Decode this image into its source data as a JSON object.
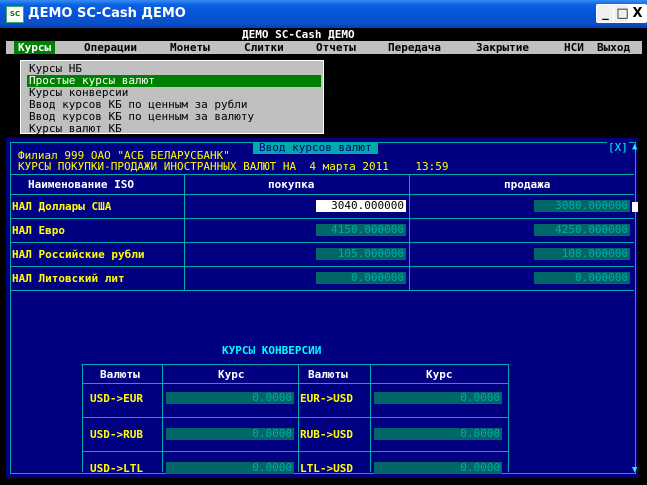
{
  "window": {
    "title": "ДЕМО SC-Cash ДЕМО",
    "icon_text": "SC",
    "min_glyph": "_",
    "max_glyph": "□",
    "close_glyph": "X"
  },
  "app_name": "ДЕМО SC-Cash ДЕМО",
  "menu": [
    {
      "label": "Курсы",
      "active": true
    },
    {
      "label": "Операции"
    },
    {
      "label": "Монеты"
    },
    {
      "label": "Слитки"
    },
    {
      "label": "Отчеты"
    },
    {
      "label": "Передача"
    },
    {
      "label": "Закрытие"
    },
    {
      "label": "НСИ"
    },
    {
      "label": "Выход"
    }
  ],
  "dropdown": [
    "Курсы НБ",
    "Простые курсы валют",
    "Курсы конверсии",
    "Ввод курсов КБ по ценным за рубли",
    "Ввод курсов КБ по ценным за валюту",
    "Курсы валют КБ"
  ],
  "dialog": {
    "title": "Ввод курсов валют",
    "close": "[X]",
    "line1": "Филиал 999 ОАО \"АСБ БЕЛАРУСБАНК\"",
    "line2": "КУРСЫ ПОКУПКИ-ПРОДАЖИ ИНОСТРАННЫХ ВАЛЮТ НА  4 марта 2011    13:59",
    "headers": {
      "name": "Наименование ISO",
      "buy": "покупка",
      "sell": "продажа"
    },
    "rows": [
      {
        "name": "НАЛ Доллары США",
        "buy": "3040.000000",
        "sell": "3080.000000"
      },
      {
        "name": "НАЛ Евро",
        "buy": "4150.000000",
        "sell": "4250.000000"
      },
      {
        "name": "НАЛ Российские рубли",
        "buy": "105.000000",
        "sell": "108.000000"
      },
      {
        "name": "НАЛ Литовский лит",
        "buy": "0.000000",
        "sell": "0.000000"
      }
    ],
    "conversion": {
      "title": "КУРСЫ КОНВЕРСИИ",
      "headers": {
        "pair1": "Валюты",
        "rate1": "Курс",
        "pair2": "Валюты",
        "rate2": "Курс"
      },
      "rows": [
        {
          "pair1": "USD->EUR",
          "rate1": "0.0000",
          "pair2": "EUR->USD",
          "rate2": "0.0000"
        },
        {
          "pair1": "USD->RUB",
          "rate1": "0.0000",
          "pair2": "RUB->USD",
          "rate2": "0.0000"
        },
        {
          "pair1": "USD->LTL",
          "rate1": "0.0000",
          "pair2": "LTL->USD",
          "rate2": "0.0000"
        }
      ]
    },
    "scroll_up": "▲",
    "scroll_down": "▼"
  }
}
